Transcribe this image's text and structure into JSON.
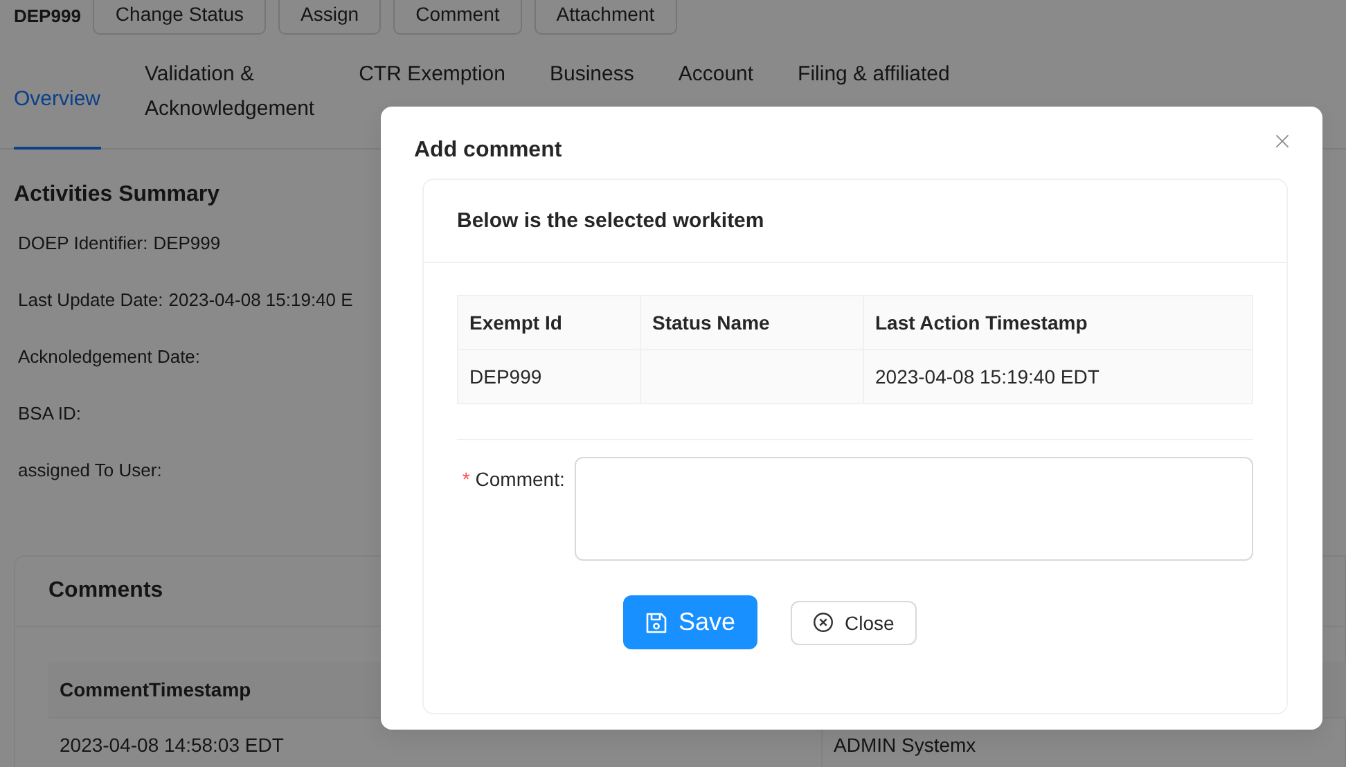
{
  "header": {
    "id": "DEP999",
    "actions": [
      "Change Status",
      "Assign",
      "Comment",
      "Attachment"
    ]
  },
  "tabs": [
    {
      "lines": [
        "Overview"
      ],
      "selected": true
    },
    {
      "lines": [
        "Validation &",
        "Acknowledgement"
      ],
      "selected": false
    },
    {
      "lines": [
        "CTR Exemption"
      ],
      "selected": false
    },
    {
      "lines": [
        "Business"
      ],
      "selected": false
    },
    {
      "lines": [
        "Account"
      ],
      "selected": false
    },
    {
      "lines": [
        "Filing & affiliated"
      ],
      "selected": false
    }
  ],
  "summary": {
    "title": "Activities Summary",
    "fields": [
      {
        "label": "DOEP Identifier:",
        "value": "DEP999"
      },
      {
        "label": "Last Update Date:",
        "value": "2023-04-08 15:19:40 E"
      },
      {
        "label": "Acknoledgement Date:"
      },
      {
        "label": "BSA ID:"
      },
      {
        "label": "assigned To User:"
      }
    ]
  },
  "comments": {
    "title": "Comments",
    "columns": [
      "CommentTimestamp"
    ],
    "rows": [
      [
        "2023-04-08 14:58:03 EDT",
        "ADMIN Systemx"
      ]
    ]
  },
  "modal": {
    "title": "Add comment",
    "card_title": "Below is the selected workitem",
    "table": {
      "columns": [
        "Exempt Id",
        "Status Name",
        "Last Action Timestamp"
      ],
      "rows": [
        {
          "exempt_id": "DEP999",
          "last_action_timestamp": "2023-04-08 15:19:40 EDT"
        }
      ]
    },
    "comment_field": {
      "label": "Comment:",
      "required_mark": "*"
    },
    "buttons": [
      {
        "label": "Save",
        "kind": "primary"
      },
      {
        "label": "Close",
        "kind": "default"
      }
    ]
  }
}
